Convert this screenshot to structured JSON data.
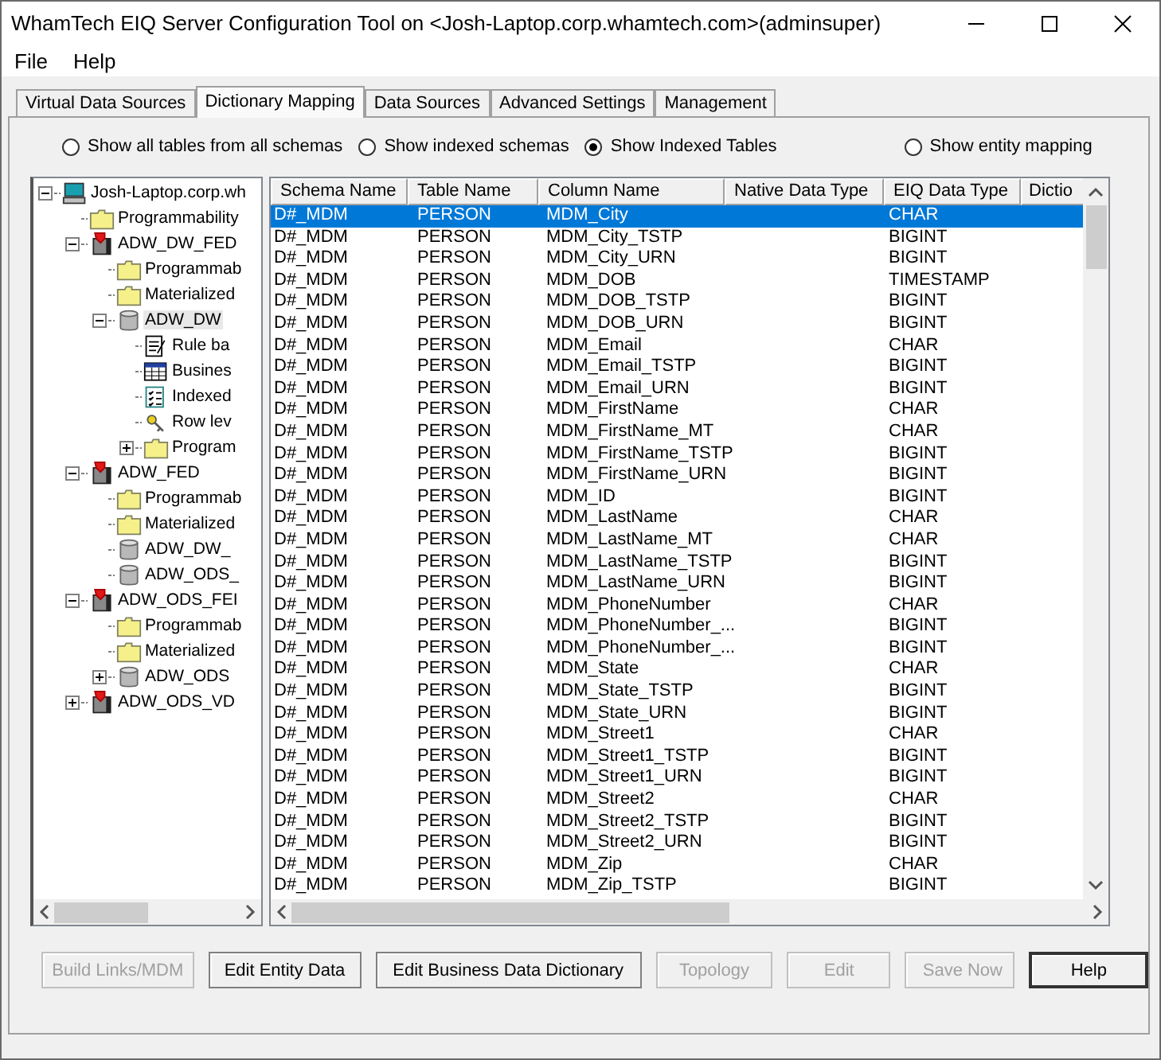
{
  "window": {
    "title": "WhamTech EIQ Server Configuration Tool on <Josh-Laptop.corp.whamtech.com>(adminsuper)"
  },
  "menu": [
    "File",
    "Help"
  ],
  "tabs": [
    {
      "label": "Virtual Data Sources",
      "selected": false
    },
    {
      "label": "Dictionary Mapping",
      "selected": true
    },
    {
      "label": "Data Sources",
      "selected": false
    },
    {
      "label": "Advanced Settings",
      "selected": false
    },
    {
      "label": "Management",
      "selected": false
    }
  ],
  "view_options": [
    {
      "label": "Show all tables from all schemas",
      "selected": false
    },
    {
      "label": "Show indexed schemas",
      "selected": false
    },
    {
      "label": "Show Indexed Tables",
      "selected": true
    },
    {
      "label": "Show entity mapping",
      "selected": false
    }
  ],
  "tree": [
    {
      "label": "Josh-Laptop.corp.wh",
      "kind": "computer",
      "expanded": true,
      "children": [
        {
          "label": "Programmability",
          "kind": "folder"
        },
        {
          "label": "ADW_DW_FED",
          "kind": "federation",
          "expanded": true,
          "children": [
            {
              "label": "Programmab",
              "kind": "folder"
            },
            {
              "label": "Materialized",
              "kind": "folder"
            },
            {
              "label": "ADW_DW",
              "kind": "database",
              "expanded": true,
              "selected": true,
              "children": [
                {
                  "label": "Rule ba",
                  "kind": "rule"
                },
                {
                  "label": "Busines",
                  "kind": "business"
                },
                {
                  "label": "Indexed",
                  "kind": "indexed"
                },
                {
                  "label": "Row lev",
                  "kind": "key"
                },
                {
                  "label": "Program",
                  "kind": "folder",
                  "expanded": false
                }
              ]
            }
          ]
        },
        {
          "label": "ADW_FED",
          "kind": "federation",
          "expanded": true,
          "children": [
            {
              "label": "Programmab",
              "kind": "folder"
            },
            {
              "label": "Materialized",
              "kind": "folder"
            },
            {
              "label": "ADW_DW_",
              "kind": "database"
            },
            {
              "label": "ADW_ODS_",
              "kind": "database"
            }
          ]
        },
        {
          "label": "ADW_ODS_FEI",
          "kind": "federation",
          "expanded": true,
          "children": [
            {
              "label": "Programmab",
              "kind": "folder"
            },
            {
              "label": "Materialized",
              "kind": "folder"
            },
            {
              "label": "ADW_ODS",
              "kind": "database",
              "expanded": false
            }
          ]
        },
        {
          "label": "ADW_ODS_VD",
          "kind": "federation",
          "expanded": false
        }
      ]
    }
  ],
  "table": {
    "columns": [
      "Schema Name",
      "Table Name",
      "Column Name",
      "Native Data Type",
      "EIQ Data Type",
      "Dictio"
    ],
    "rows": [
      {
        "cells": [
          "D#_MDM",
          "PERSON",
          "MDM_City",
          "",
          "CHAR"
        ],
        "selected": true
      },
      {
        "cells": [
          "D#_MDM",
          "PERSON",
          "MDM_City_TSTP",
          "",
          "BIGINT"
        ],
        "selected": false
      },
      {
        "cells": [
          "D#_MDM",
          "PERSON",
          "MDM_City_URN",
          "",
          "BIGINT"
        ],
        "selected": false
      },
      {
        "cells": [
          "D#_MDM",
          "PERSON",
          "MDM_DOB",
          "",
          "TIMESTAMP"
        ],
        "selected": false
      },
      {
        "cells": [
          "D#_MDM",
          "PERSON",
          "MDM_DOB_TSTP",
          "",
          "BIGINT"
        ],
        "selected": false
      },
      {
        "cells": [
          "D#_MDM",
          "PERSON",
          "MDM_DOB_URN",
          "",
          "BIGINT"
        ],
        "selected": false
      },
      {
        "cells": [
          "D#_MDM",
          "PERSON",
          "MDM_Email",
          "",
          "CHAR"
        ],
        "selected": false
      },
      {
        "cells": [
          "D#_MDM",
          "PERSON",
          "MDM_Email_TSTP",
          "",
          "BIGINT"
        ],
        "selected": false
      },
      {
        "cells": [
          "D#_MDM",
          "PERSON",
          "MDM_Email_URN",
          "",
          "BIGINT"
        ],
        "selected": false
      },
      {
        "cells": [
          "D#_MDM",
          "PERSON",
          "MDM_FirstName",
          "",
          "CHAR"
        ],
        "selected": false
      },
      {
        "cells": [
          "D#_MDM",
          "PERSON",
          "MDM_FirstName_MT",
          "",
          "CHAR"
        ],
        "selected": false
      },
      {
        "cells": [
          "D#_MDM",
          "PERSON",
          "MDM_FirstName_TSTP",
          "",
          "BIGINT"
        ],
        "selected": false
      },
      {
        "cells": [
          "D#_MDM",
          "PERSON",
          "MDM_FirstName_URN",
          "",
          "BIGINT"
        ],
        "selected": false
      },
      {
        "cells": [
          "D#_MDM",
          "PERSON",
          "MDM_ID",
          "",
          "BIGINT"
        ],
        "selected": false
      },
      {
        "cells": [
          "D#_MDM",
          "PERSON",
          "MDM_LastName",
          "",
          "CHAR"
        ],
        "selected": false
      },
      {
        "cells": [
          "D#_MDM",
          "PERSON",
          "MDM_LastName_MT",
          "",
          "CHAR"
        ],
        "selected": false
      },
      {
        "cells": [
          "D#_MDM",
          "PERSON",
          "MDM_LastName_TSTP",
          "",
          "BIGINT"
        ],
        "selected": false
      },
      {
        "cells": [
          "D#_MDM",
          "PERSON",
          "MDM_LastName_URN",
          "",
          "BIGINT"
        ],
        "selected": false
      },
      {
        "cells": [
          "D#_MDM",
          "PERSON",
          "MDM_PhoneNumber",
          "",
          "CHAR"
        ],
        "selected": false
      },
      {
        "cells": [
          "D#_MDM",
          "PERSON",
          "MDM_PhoneNumber_...",
          "",
          "BIGINT"
        ],
        "selected": false
      },
      {
        "cells": [
          "D#_MDM",
          "PERSON",
          "MDM_PhoneNumber_...",
          "",
          "BIGINT"
        ],
        "selected": false
      },
      {
        "cells": [
          "D#_MDM",
          "PERSON",
          "MDM_State",
          "",
          "CHAR"
        ],
        "selected": false
      },
      {
        "cells": [
          "D#_MDM",
          "PERSON",
          "MDM_State_TSTP",
          "",
          "BIGINT"
        ],
        "selected": false
      },
      {
        "cells": [
          "D#_MDM",
          "PERSON",
          "MDM_State_URN",
          "",
          "BIGINT"
        ],
        "selected": false
      },
      {
        "cells": [
          "D#_MDM",
          "PERSON",
          "MDM_Street1",
          "",
          "CHAR"
        ],
        "selected": false
      },
      {
        "cells": [
          "D#_MDM",
          "PERSON",
          "MDM_Street1_TSTP",
          "",
          "BIGINT"
        ],
        "selected": false
      },
      {
        "cells": [
          "D#_MDM",
          "PERSON",
          "MDM_Street1_URN",
          "",
          "BIGINT"
        ],
        "selected": false
      },
      {
        "cells": [
          "D#_MDM",
          "PERSON",
          "MDM_Street2",
          "",
          "CHAR"
        ],
        "selected": false
      },
      {
        "cells": [
          "D#_MDM",
          "PERSON",
          "MDM_Street2_TSTP",
          "",
          "BIGINT"
        ],
        "selected": false
      },
      {
        "cells": [
          "D#_MDM",
          "PERSON",
          "MDM_Street2_URN",
          "",
          "BIGINT"
        ],
        "selected": false
      },
      {
        "cells": [
          "D#_MDM",
          "PERSON",
          "MDM_Zip",
          "",
          "CHAR"
        ],
        "selected": false
      },
      {
        "cells": [
          "D#_MDM",
          "PERSON",
          "MDM_Zip_TSTP",
          "",
          "BIGINT"
        ],
        "selected": false
      }
    ]
  },
  "buttons": [
    {
      "label": "Build Links/MDM",
      "disabled": true,
      "default": false
    },
    {
      "label": "Edit Entity Data",
      "disabled": false,
      "default": false
    },
    {
      "label": "Edit Business Data Dictionary",
      "disabled": false,
      "default": false
    },
    {
      "label": "Topology",
      "disabled": true,
      "default": false
    },
    {
      "label": "Edit",
      "disabled": true,
      "default": false
    },
    {
      "label": "Save Now",
      "disabled": true,
      "default": false
    },
    {
      "label": "Help",
      "disabled": false,
      "default": true
    }
  ]
}
